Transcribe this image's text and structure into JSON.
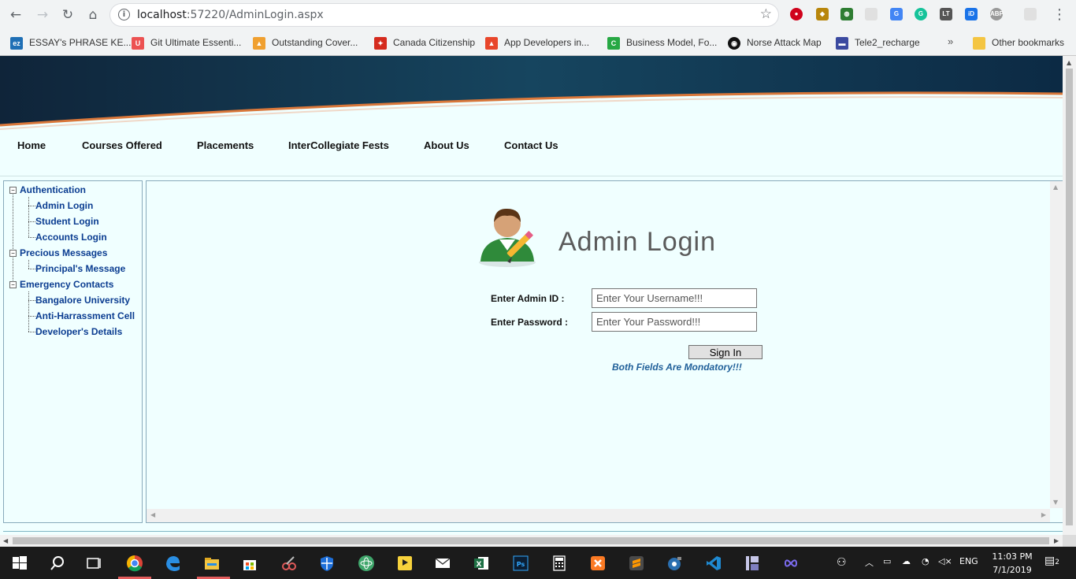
{
  "browser": {
    "url_host": "localhost",
    "url_rest": ":57220/AdminLogin.aspx",
    "bookmarks": [
      {
        "label": "ESSAY's PHRASE KE...",
        "icon": "ez-icon",
        "color": "#1f6fb5",
        "glyph": "ez"
      },
      {
        "label": "Git Ultimate Essenti...",
        "icon": "udemy-icon",
        "color": "#ec5252",
        "glyph": "U"
      },
      {
        "label": "Outstanding Cover...",
        "icon": "chart-icon",
        "color": "#f0a030",
        "glyph": "▲"
      },
      {
        "label": "Canada Citizenship",
        "icon": "maple-leaf-icon",
        "color": "#d52b1e",
        "glyph": "✦"
      },
      {
        "label": "App Developers in...",
        "icon": "arrow-up-icon",
        "color": "#e8462b",
        "glyph": "▲"
      },
      {
        "label": "Business Model, Fo...",
        "icon": "c-icon",
        "color": "#27a844",
        "glyph": "C"
      },
      {
        "label": "Norse Attack Map",
        "icon": "norse-icon",
        "color": "#111111",
        "glyph": "◉"
      },
      {
        "label": "Tele2_recharge",
        "icon": "flag-icon",
        "color": "#3b4aa0",
        "glyph": "▬"
      }
    ],
    "more": "»",
    "other_bookmarks": "Other bookmarks"
  },
  "site": {
    "menu": [
      "Home",
      "Courses Offered",
      "Placements",
      "InterCollegiate Fests",
      "About Us",
      "Contact Us"
    ],
    "tree": {
      "groups": [
        {
          "label": "Authentication",
          "items": [
            "Admin Login",
            "Student Login",
            "Accounts Login"
          ]
        },
        {
          "label": "Precious Messages",
          "items": [
            "Principal's Message"
          ]
        },
        {
          "label": "Emergency Contacts",
          "items": [
            "Bangalore University",
            "Anti-Harrassment Cell",
            "Developer's Details"
          ]
        }
      ],
      "toggle": "−"
    },
    "login": {
      "title": "Admin Login",
      "id_label": "Enter Admin ID :",
      "id_placeholder": "Enter Your Username!!!",
      "password_label": "Enter Password :",
      "password_placeholder": "Enter Your Password!!!",
      "button": "Sign In",
      "note": "Both Fields Are Mondatory!!!"
    }
  },
  "taskbar": {
    "lang": "ENG",
    "time": "11:03 PM",
    "date": "7/1/2019",
    "notifications": "2"
  },
  "colors": {
    "page_bg": "#f0ffff",
    "banner_dark": "#0e2a45",
    "banner_accent": "#d9773a",
    "link": "#0b3d91",
    "note": "#1f5f99"
  }
}
